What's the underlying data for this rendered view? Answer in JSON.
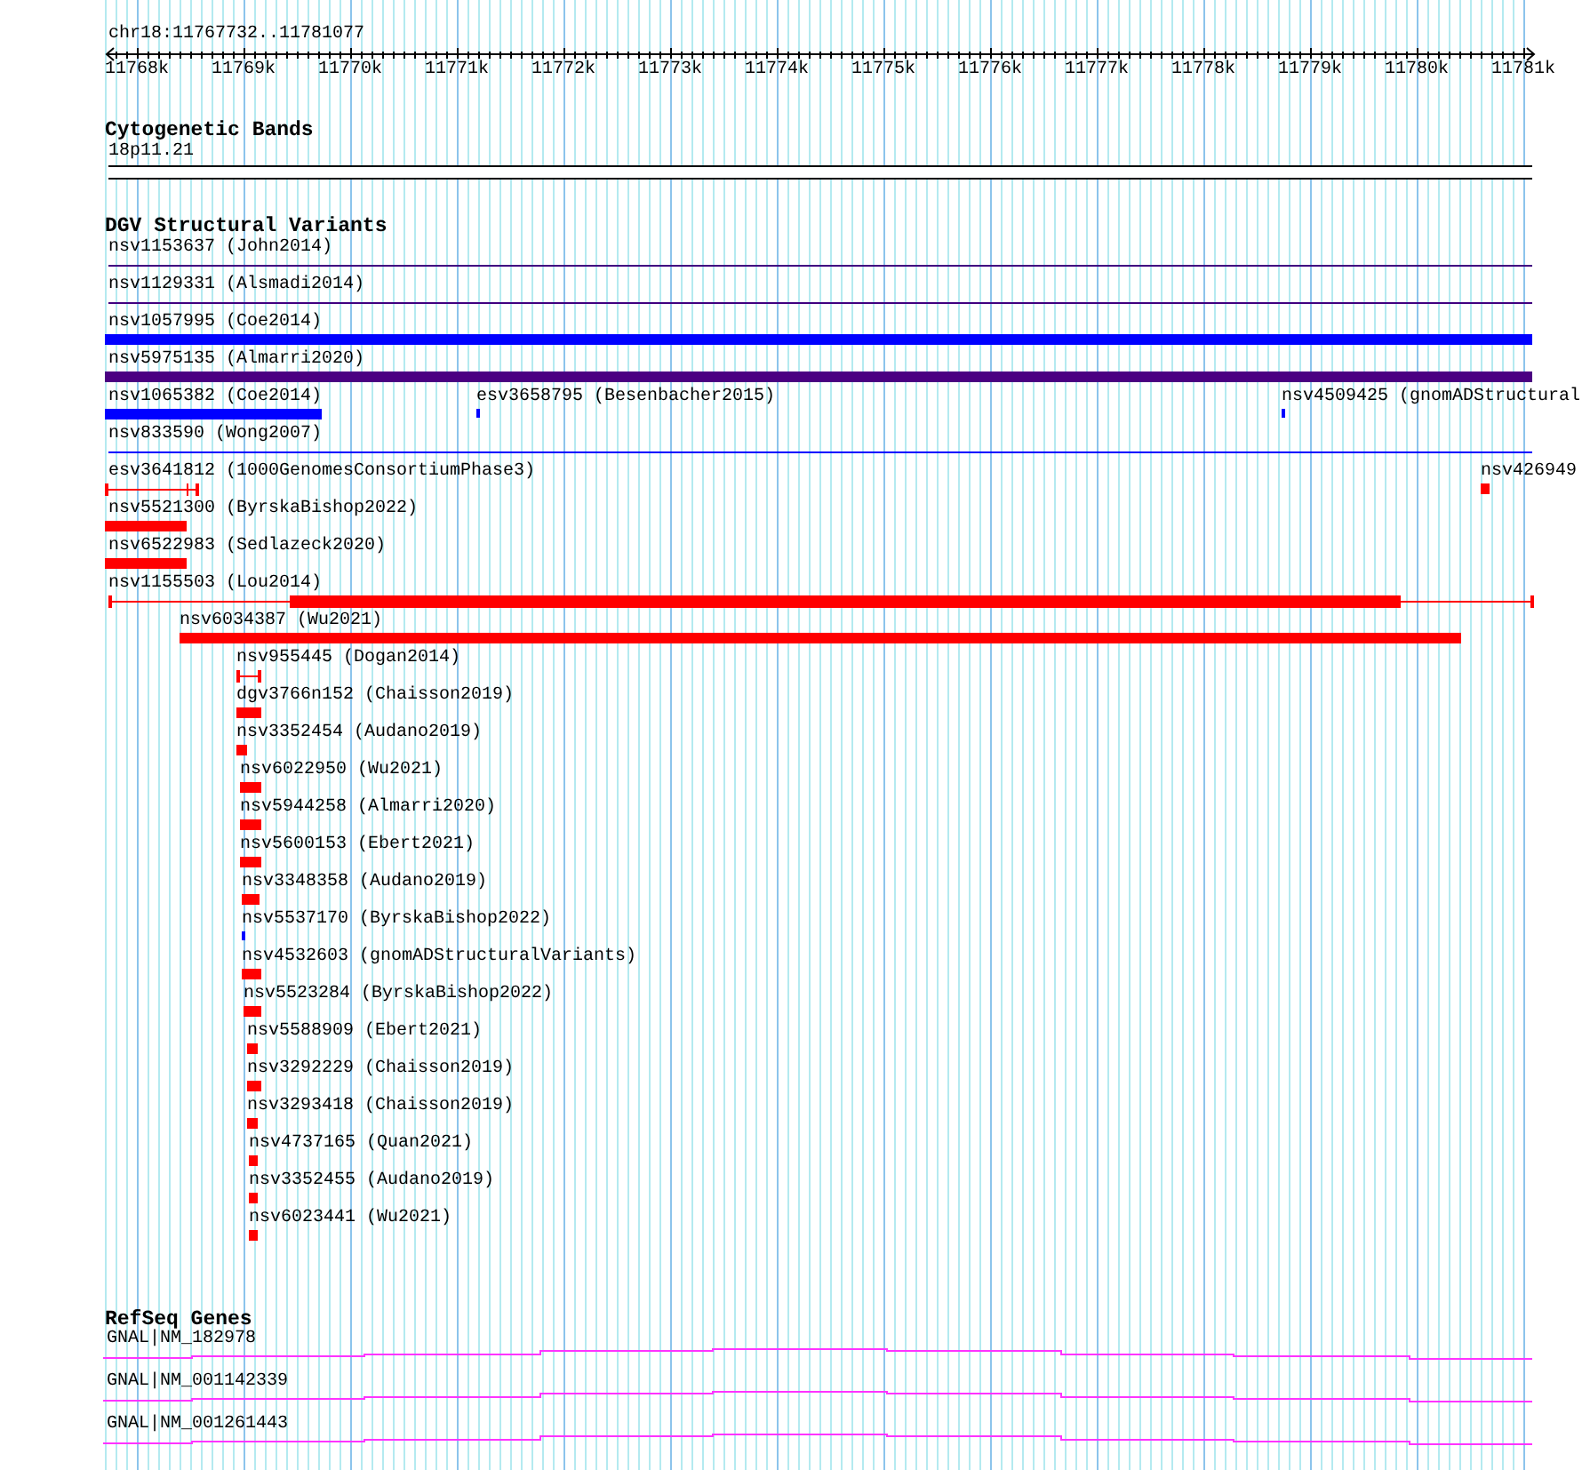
{
  "ruler": {
    "region": "chr18:11767732..11781077",
    "ticks": [
      "11768k",
      "11769k",
      "11770k",
      "11771k",
      "11772k",
      "11773k",
      "11774k",
      "11775k",
      "11776k",
      "11777k",
      "11778k",
      "11779k",
      "11780k",
      "11781k"
    ]
  },
  "tracks": [
    {
      "title": "Cytogenetic Bands",
      "features": [
        {
          "label": "18p11.21",
          "kind": "band"
        }
      ]
    },
    {
      "title": "DGV Structural Variants",
      "features": [
        {
          "label": "nsv1153637 (John2014)",
          "kind": "line",
          "color": "#400080"
        },
        {
          "label": "nsv1129331 (Alsmadi2014)",
          "kind": "line",
          "color": "#400080"
        },
        {
          "label": "nsv1057995 (Coe2014)",
          "kind": "bar",
          "color": "#0000ff"
        },
        {
          "label": "nsv5975135 (Almarri2020)",
          "kind": "bar",
          "color": "#4b0082"
        },
        {
          "label": "nsv1065382 (Coe2014)",
          "kind": "bar",
          "color": "#0000ff"
        },
        {
          "label": "esv3658795 (Besenbacher2015)",
          "kind": "bar",
          "color": "#0000ff"
        },
        {
          "label": "nsv4509425 (gnomADStructural",
          "kind": "bar",
          "color": "#0000ff"
        },
        {
          "label": "nsv833590 (Wong2007)",
          "kind": "line",
          "color": "#0000ff"
        },
        {
          "label": "esv3641812 (1000GenomesConsortiumPhase3)",
          "kind": "span",
          "color": "#ff0000"
        },
        {
          "label": "nsv426949",
          "kind": "bar",
          "color": "#ff0000"
        },
        {
          "label": "nsv5521300 (ByrskaBishop2022)",
          "kind": "bar",
          "color": "#ff0000"
        },
        {
          "label": "nsv6522983 (Sedlazeck2020)",
          "kind": "bar",
          "color": "#ff0000"
        },
        {
          "label": "nsv1155503 (Lou2014)",
          "kind": "span",
          "color": "#ff0000"
        },
        {
          "label": "nsv6034387 (Wu2021)",
          "kind": "bar",
          "color": "#ff0000"
        },
        {
          "label": "nsv955445 (Dogan2014)",
          "kind": "span",
          "color": "#ff0000"
        },
        {
          "label": "dgv3766n152 (Chaisson2019)",
          "kind": "bar",
          "color": "#ff0000"
        },
        {
          "label": "nsv3352454 (Audano2019)",
          "kind": "bar",
          "color": "#ff0000"
        },
        {
          "label": "nsv6022950 (Wu2021)",
          "kind": "bar",
          "color": "#ff0000"
        },
        {
          "label": "nsv5944258 (Almarri2020)",
          "kind": "bar",
          "color": "#ff0000"
        },
        {
          "label": "nsv5600153 (Ebert2021)",
          "kind": "bar",
          "color": "#ff0000"
        },
        {
          "label": "nsv3348358 (Audano2019)",
          "kind": "bar",
          "color": "#ff0000"
        },
        {
          "label": "nsv5537170 (ByrskaBishop2022)",
          "kind": "bar",
          "color": "#0000ff"
        },
        {
          "label": "nsv4532603 (gnomADStructuralVariants)",
          "kind": "bar",
          "color": "#ff0000"
        },
        {
          "label": "nsv5523284 (ByrskaBishop2022)",
          "kind": "bar",
          "color": "#ff0000"
        },
        {
          "label": "nsv5588909 (Ebert2021)",
          "kind": "bar",
          "color": "#ff0000"
        },
        {
          "label": "nsv3292229 (Chaisson2019)",
          "kind": "bar",
          "color": "#ff0000"
        },
        {
          "label": "nsv3293418 (Chaisson2019)",
          "kind": "bar",
          "color": "#ff0000"
        },
        {
          "label": "nsv4737165 (Quan2021)",
          "kind": "bar",
          "color": "#ff0000"
        },
        {
          "label": "nsv3352455 (Audano2019)",
          "kind": "bar",
          "color": "#ff0000"
        },
        {
          "label": "nsv6023441 (Wu2021)",
          "kind": "bar",
          "color": "#ff0000"
        }
      ]
    },
    {
      "title": "RefSeq Genes",
      "features": [
        {
          "label": "GNAL|NM_182978",
          "kind": "gene"
        },
        {
          "label": "GNAL|NM_001142339",
          "kind": "gene"
        },
        {
          "label": "GNAL|NM_001261443",
          "kind": "gene"
        }
      ]
    }
  ]
}
